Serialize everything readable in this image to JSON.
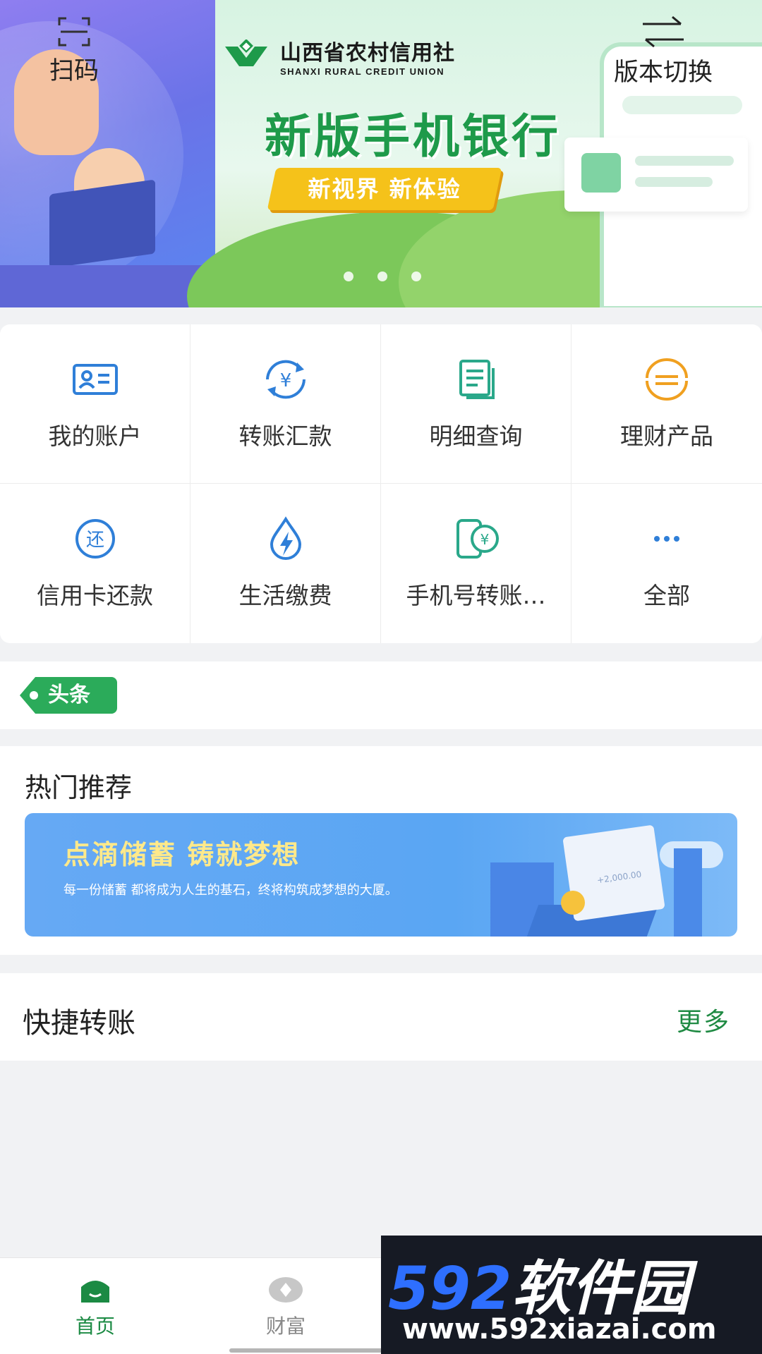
{
  "header": {
    "scan_label": "扫码",
    "switch_label": "版本切换"
  },
  "banner": {
    "brand_cn": "山西省农村信用社",
    "brand_en": "SHANXI RURAL CREDIT UNION",
    "headline": "新版手机银行",
    "slogan": "新视界 新体验",
    "page_count": 3,
    "colors": {
      "brand_green": "#1e9a4a",
      "ribbon": "#f5c21a"
    }
  },
  "menu": {
    "items": [
      {
        "label": "我的账户",
        "icon": "account-card-icon"
      },
      {
        "label": "转账汇款",
        "icon": "transfer-yen-icon"
      },
      {
        "label": "明细查询",
        "icon": "statement-icon"
      },
      {
        "label": "理财产品",
        "icon": "wealth-product-icon"
      },
      {
        "label": "信用卡还款",
        "icon": "credit-repay-icon"
      },
      {
        "label": "生活缴费",
        "icon": "utility-drop-icon"
      },
      {
        "label": "手机号转账…",
        "icon": "phone-transfer-icon"
      },
      {
        "label": "全部",
        "icon": "more-dots-icon"
      }
    ]
  },
  "news": {
    "tag": "头条"
  },
  "hot": {
    "title": "热门推荐",
    "banner_title": "点滴储蓄 铸就梦想",
    "banner_text": "每一份储蓄 都将成为人生的基石，终将构筑成梦想的大厦。",
    "banner_amount": "+2,000.00"
  },
  "quick": {
    "title": "快捷转账",
    "more": "更多"
  },
  "tabbar": {
    "tabs": [
      {
        "label": "首页",
        "active": true
      },
      {
        "label": "财富",
        "active": false
      }
    ],
    "active_color": "#1b8a43"
  },
  "watermark": {
    "digits": "592",
    "brand": "软件园",
    "url": "www.592xiazai.com"
  }
}
